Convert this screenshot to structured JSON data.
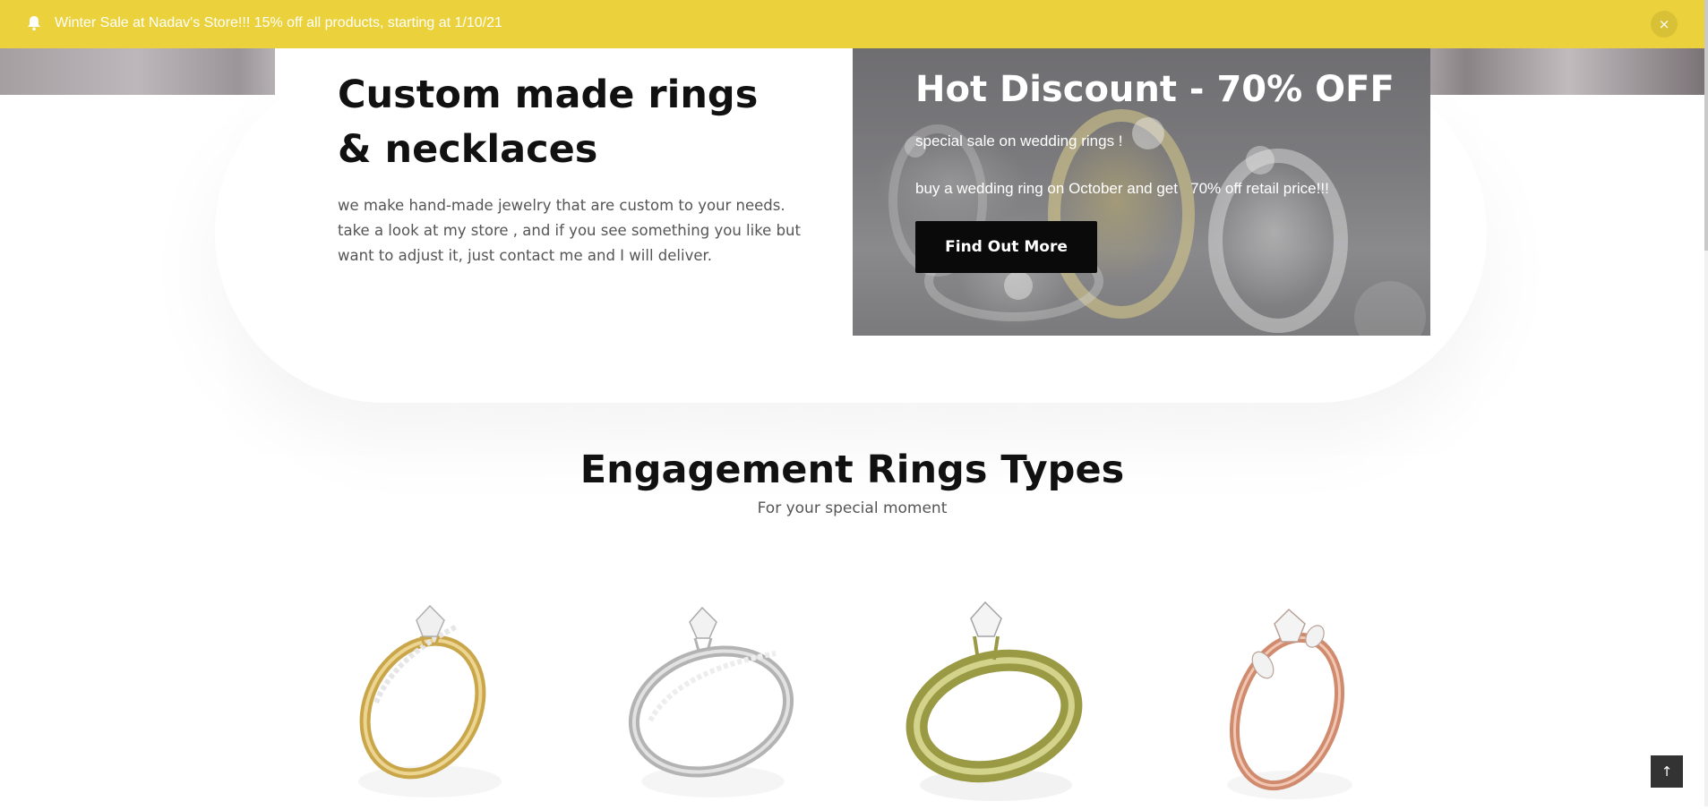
{
  "announcement": {
    "text": "Winter Sale at Nadav's Store!!! 15% off all products, starting at 1/10/21",
    "close_label": "×",
    "icon": "bell-icon"
  },
  "intro": {
    "title": "Custom made rings & necklaces",
    "body": "we make hand-made jewelry that are custom to your needs.\n take a look at my store , and if you see something you like but want to adjust it, just contact me and I will deliver."
  },
  "promo": {
    "title": "Hot Discount - 70% OFF",
    "line1": "special sale on wedding rings !",
    "line2": "buy a wedding ring on October and get   70% off retail price!!!",
    "button_label": "Find Out More"
  },
  "section": {
    "title": "Engagement Rings Types",
    "subtitle": "For your special moment"
  },
  "rings": [
    {
      "name": "yellow-gold-pave-ring",
      "metal": "#d8b75a"
    },
    {
      "name": "white-gold-pave-ring",
      "metal": "#bfbfbf"
    },
    {
      "name": "green-gold-solitaire-ring",
      "metal": "#a8a655"
    },
    {
      "name": "rose-gold-three-stone-ring",
      "metal": "#d59d82"
    }
  ],
  "back_to_top": {
    "label": "↑"
  },
  "colors": {
    "announcement_bg": "#ebd23c",
    "button_bg": "#0a0a0a",
    "heading": "#111111",
    "body_text": "#555555"
  }
}
